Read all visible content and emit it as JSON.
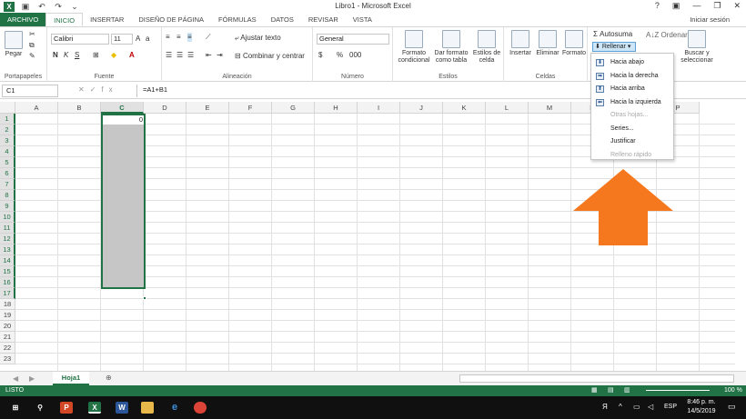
{
  "window": {
    "title": "Libro1 - Microsoft Excel",
    "sign_in": "Iniciar sesión"
  },
  "tabs": [
    "ARCHIVO",
    "INICIO",
    "INSERTAR",
    "DISEÑO DE PÁGINA",
    "FÓRMULAS",
    "DATOS",
    "REVISAR",
    "VISTA"
  ],
  "ribbon": {
    "clipboard": {
      "paste": "Pegar",
      "label": "Portapapeles"
    },
    "font": {
      "name": "Calibri",
      "size": "11",
      "bold": "N",
      "italic": "K",
      "underline": "S",
      "label": "Fuente"
    },
    "alignment": {
      "wrap": "Ajustar texto",
      "merge": "Combinar y centrar",
      "label": "Alineación"
    },
    "number": {
      "format": "General",
      "label": "Número"
    },
    "styles": {
      "conditional": "Formato condicional",
      "table": "Dar formato como tabla",
      "cell": "Estilos de celda",
      "label": "Estilos"
    },
    "cells": {
      "insert": "Insertar",
      "delete": "Eliminar",
      "format": "Formato",
      "label": "Celdas"
    },
    "editing": {
      "autosum": "Autosuma",
      "fill": "Rellenar",
      "sort": "Ordenar y",
      "find": "Buscar y seleccionar"
    }
  },
  "fill_menu": [
    {
      "label": "Hacia abajo",
      "enabled": true
    },
    {
      "label": "Hacia la derecha",
      "enabled": true
    },
    {
      "label": "Hacia arriba",
      "enabled": true
    },
    {
      "label": "Hacia la izquierda",
      "enabled": true
    },
    {
      "label": "Otras hojas...",
      "enabled": false
    },
    {
      "label": "Series...",
      "enabled": true
    },
    {
      "label": "Justificar",
      "enabled": true
    },
    {
      "label": "Relleno rápido",
      "enabled": false
    }
  ],
  "formula_bar": {
    "name_box": "C1",
    "formula": "=A1+B1"
  },
  "grid": {
    "columns": [
      "A",
      "B",
      "C",
      "D",
      "E",
      "F",
      "G",
      "H",
      "I",
      "J",
      "K",
      "L",
      "M",
      "N",
      "O",
      "P"
    ],
    "rows": [
      "1",
      "2",
      "3",
      "4",
      "5",
      "6",
      "7",
      "8",
      "9",
      "10",
      "11",
      "12",
      "13",
      "14",
      "15",
      "16",
      "17",
      "18",
      "19",
      "20",
      "21",
      "22",
      "23"
    ],
    "selected_column": "C",
    "selected_rows": [
      "1",
      "2",
      "3",
      "4",
      "5",
      "6",
      "7",
      "8",
      "9",
      "10",
      "11",
      "12",
      "13",
      "14",
      "15",
      "16",
      "17"
    ],
    "active_cell_value": "0"
  },
  "sheets": [
    "Hoja1"
  ],
  "status": {
    "mode": "LISTO",
    "zoom": "100 %"
  },
  "taskbar": {
    "time": "8:46 p. m.",
    "date": "14/5/2019",
    "lang": "ESP"
  },
  "colors": {
    "excel_green": "#217346",
    "arrow_orange": "#f5781e",
    "selection_gray": "#c6c6c6"
  }
}
